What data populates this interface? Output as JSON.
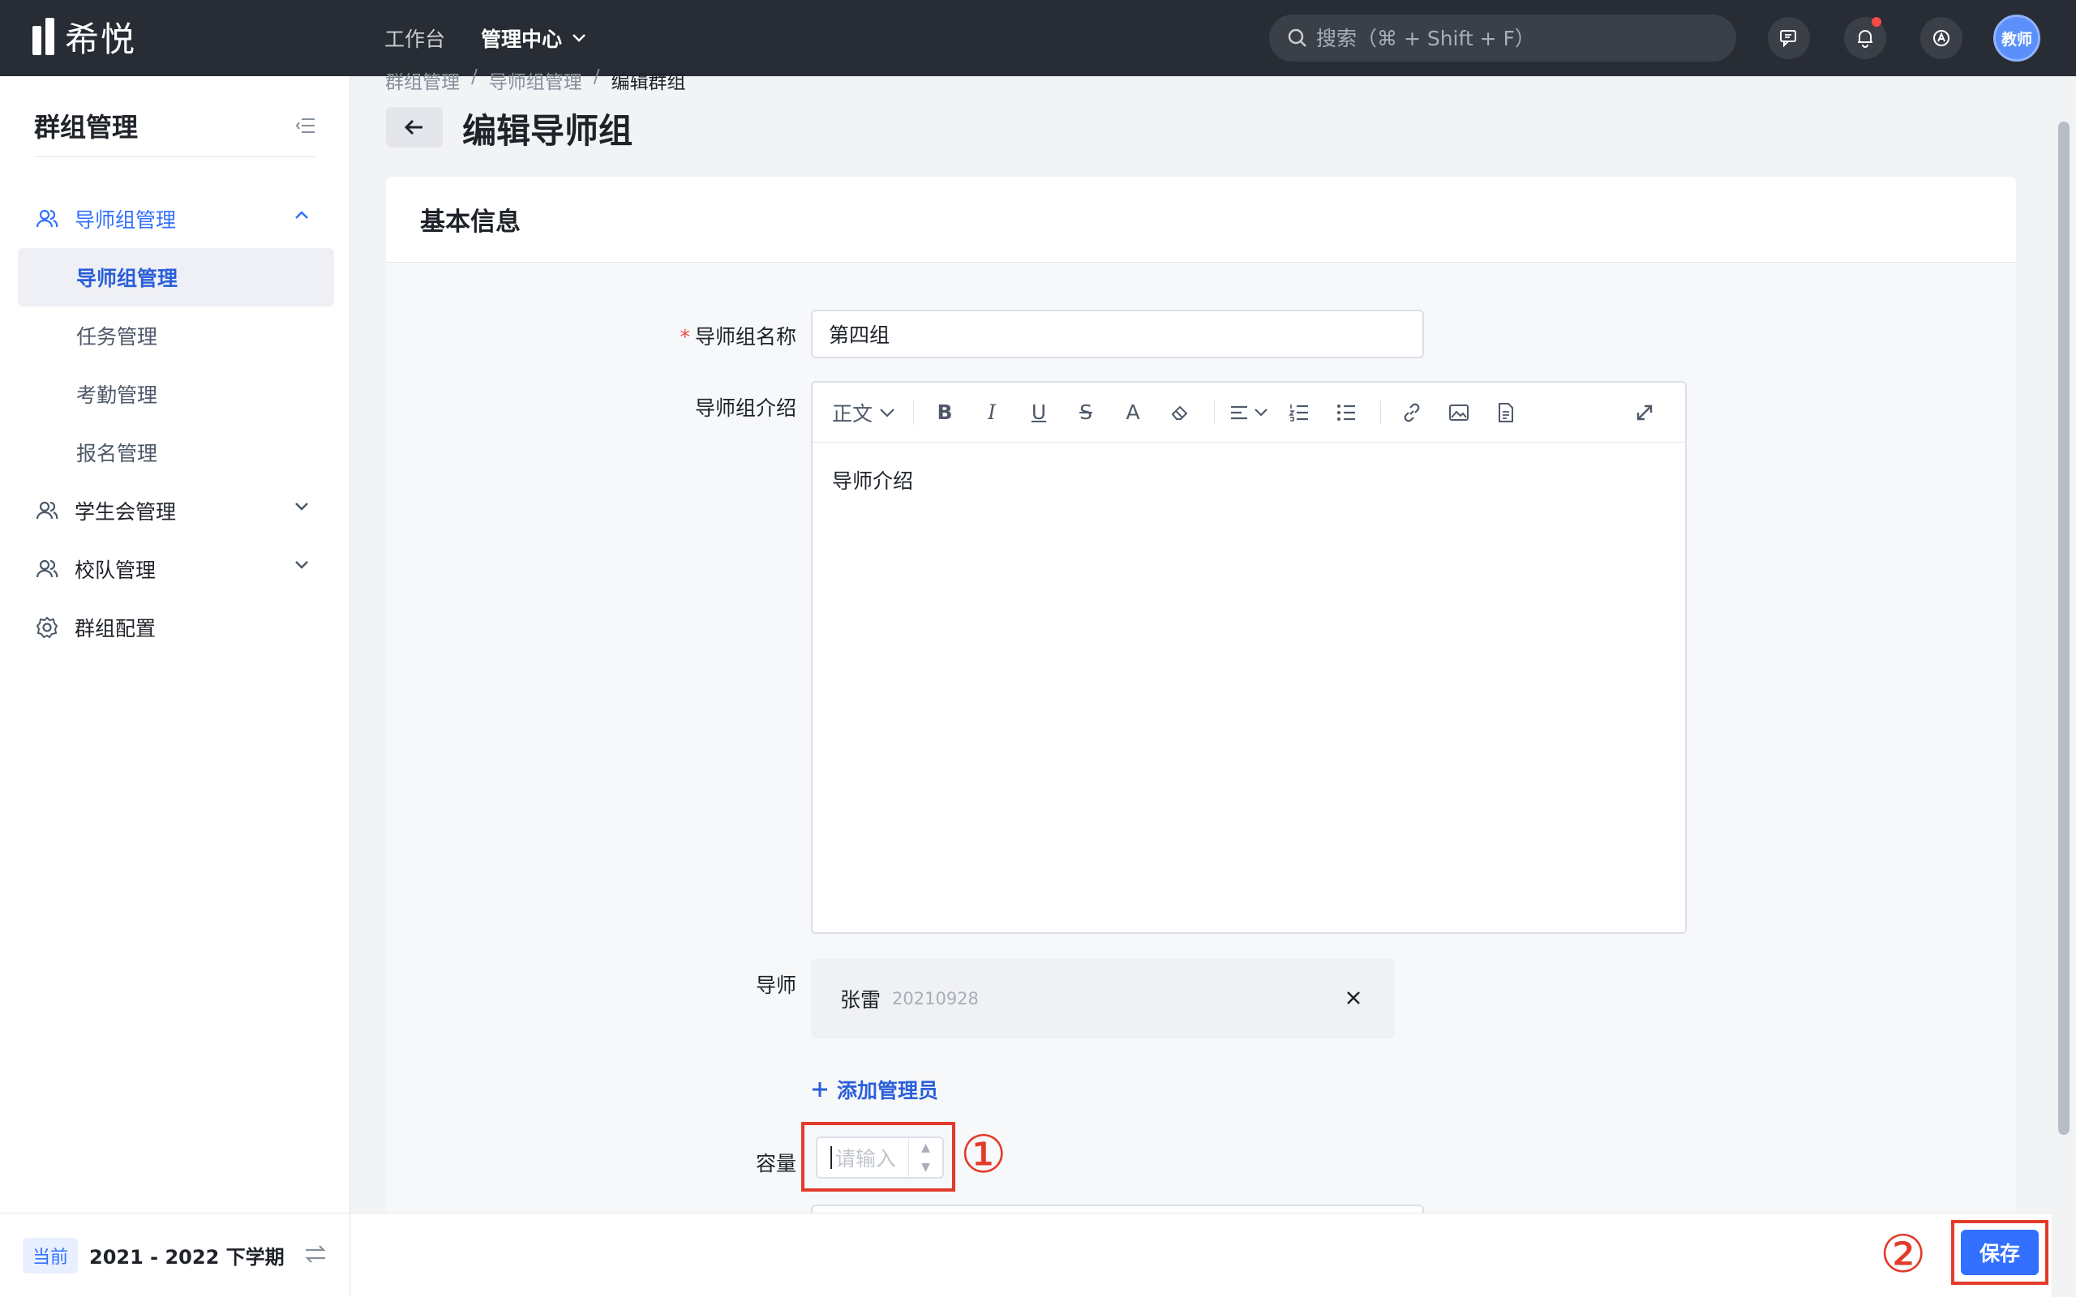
{
  "app": {
    "logo_text": "希悦"
  },
  "topnav": {
    "items": [
      "工作台",
      "管理中心"
    ]
  },
  "search": {
    "placeholder": "搜索（⌘ + Shift + F）"
  },
  "user": {
    "avatar_text": "教师"
  },
  "sidebar": {
    "title": "群组管理",
    "groups": [
      {
        "label": "导师组管理",
        "expanded": true,
        "children": [
          "导师组管理",
          "任务管理",
          "考勤管理",
          "报名管理"
        ],
        "selected": "导师组管理"
      },
      {
        "label": "学生会管理",
        "expanded": false
      },
      {
        "label": "校队管理",
        "expanded": false
      },
      {
        "label": "群组配置",
        "expanded": false
      }
    ],
    "term_tag": "当前",
    "term": "2021 - 2022 下学期"
  },
  "breadcrumb": [
    "群组管理",
    "导师组管理",
    "编辑群组"
  ],
  "breadcrumb_sep": "/",
  "page_title": "编辑导师组",
  "card": {
    "title": "基本信息",
    "fields": {
      "name_label": "导师组名称",
      "name_value": "第四组",
      "intro_label": "导师组介绍",
      "intro_content": "导师介绍",
      "mentor_label": "导师",
      "mentor_name": "张雷",
      "mentor_id": "20210928",
      "add_admin": "添加管理员",
      "capacity_label": "容量",
      "capacity_placeholder": "请输入"
    },
    "editor_toolbar": {
      "paragraph": "正文",
      "bold": "B",
      "italic": "I",
      "underline": "U",
      "strike": "S",
      "font_color": "A"
    }
  },
  "annotations": {
    "marker_1": "①",
    "marker_2": "②"
  },
  "footer": {
    "save_label": "保存"
  },
  "colors": {
    "topbar": "#282c34",
    "primary": "#3370ff",
    "annotation": "#e23b2a",
    "required": "#f54a45"
  }
}
